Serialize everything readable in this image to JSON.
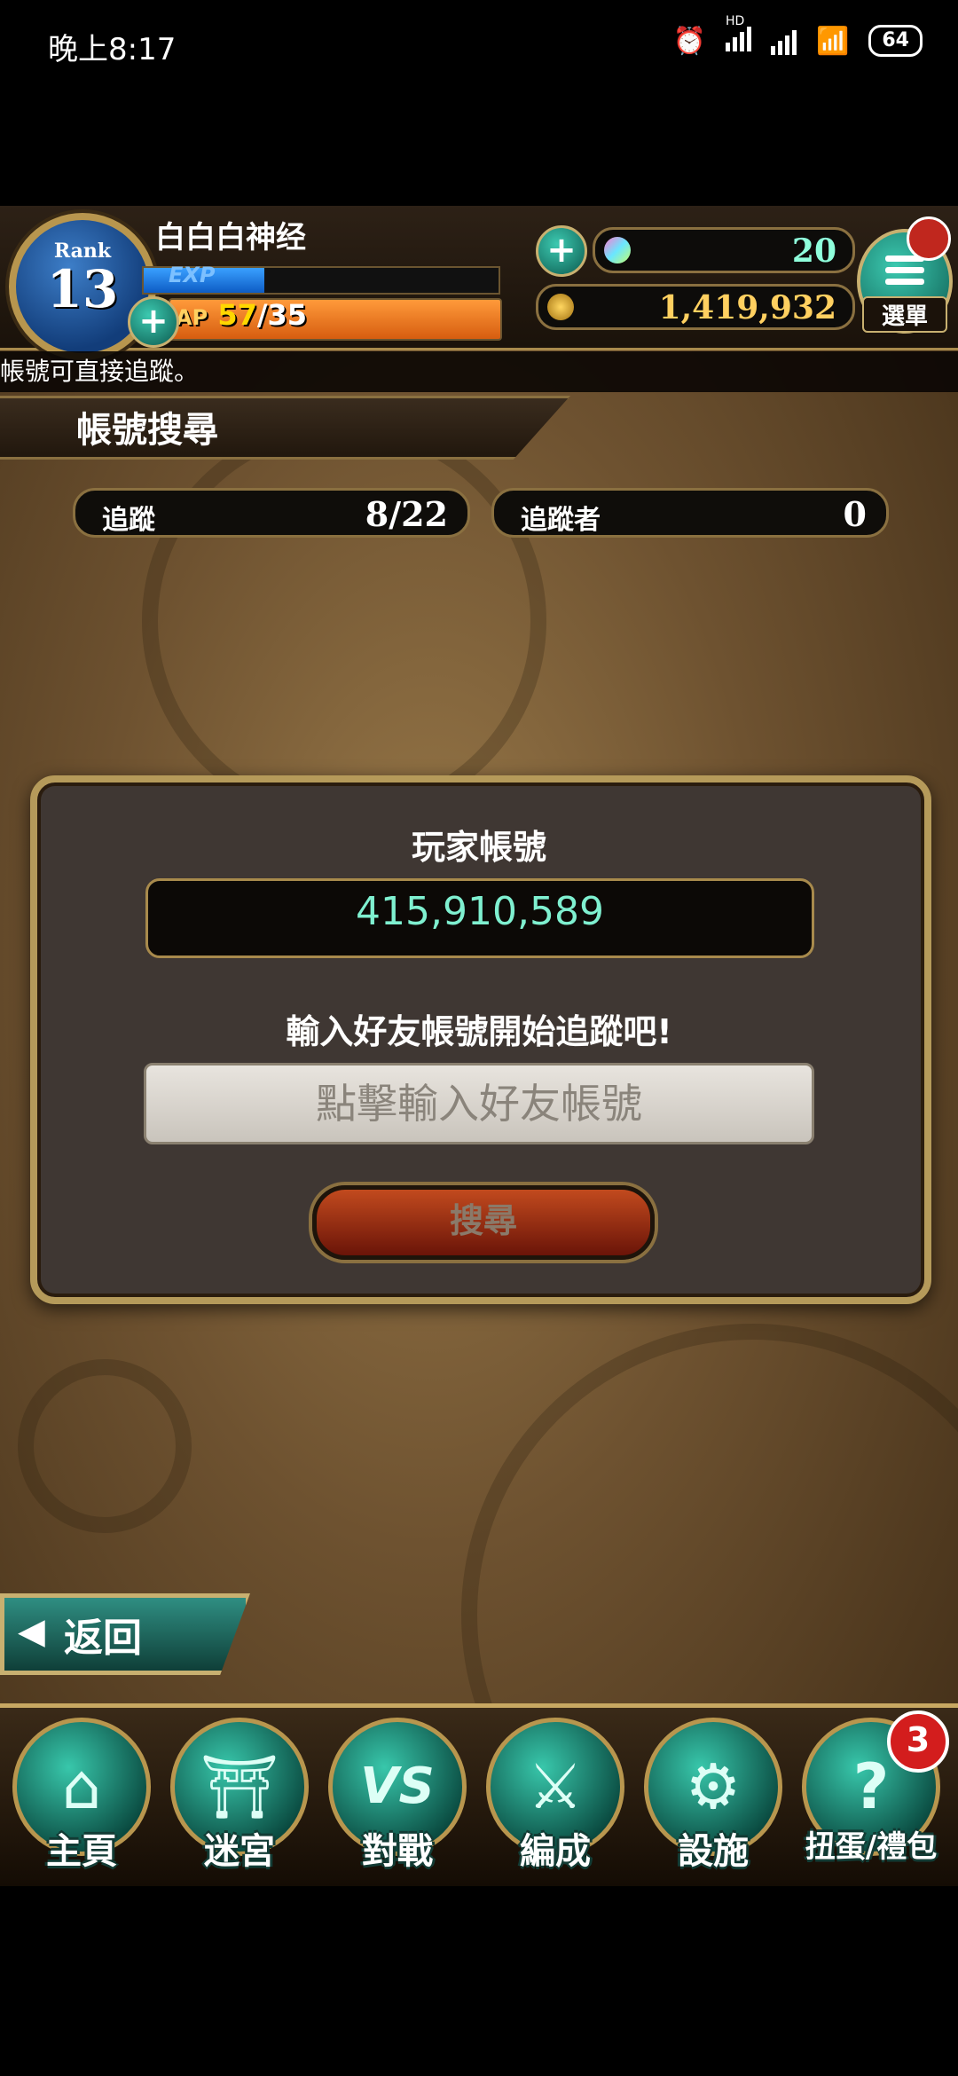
{
  "status_bar": {
    "time": "晚上8:17",
    "hd": "HD",
    "battery": "64",
    "icons": [
      "alarm-icon",
      "signal-icon",
      "signal-icon",
      "wifi-icon",
      "battery-icon"
    ]
  },
  "header": {
    "rank_label": "Rank",
    "rank_value": "13",
    "player_name": "白白白神经",
    "exp_label": "EXP",
    "exp_progress": 0.34,
    "ap_label": "AP",
    "ap_current": "57",
    "ap_max": "/35",
    "gems": "20",
    "gold": "1,419,932",
    "menu_label": "選單"
  },
  "ticker": "帳號可直接追蹤。",
  "section_title": "帳號搜尋",
  "stats": {
    "follow_label": "追蹤",
    "follow_value": "8/22",
    "follower_label": "追蹤者",
    "follower_value": "0"
  },
  "dialog": {
    "title": "玩家帳號",
    "account_id": "415,910,589",
    "prompt": "輸入好友帳號開始追蹤吧!",
    "input_placeholder": "點擊輸入好友帳號",
    "search_label": "搜尋"
  },
  "back_label": "返回",
  "nav": {
    "items": [
      {
        "label": "主頁",
        "icon": "home-tower-icon"
      },
      {
        "label": "迷宮",
        "icon": "dungeon-gate-icon"
      },
      {
        "label": "對戰",
        "icon": "vs-icon"
      },
      {
        "label": "編成",
        "icon": "party-formation-icon"
      },
      {
        "label": "設施",
        "icon": "gear-facility-icon"
      },
      {
        "label": "扭蛋/禮包",
        "icon": "gacha-box-icon"
      }
    ],
    "badge_count": "3"
  },
  "colors": {
    "accent_teal": "#38c7ab",
    "frame_gold": "#b8964e",
    "account_text": "#7ff0d0"
  }
}
